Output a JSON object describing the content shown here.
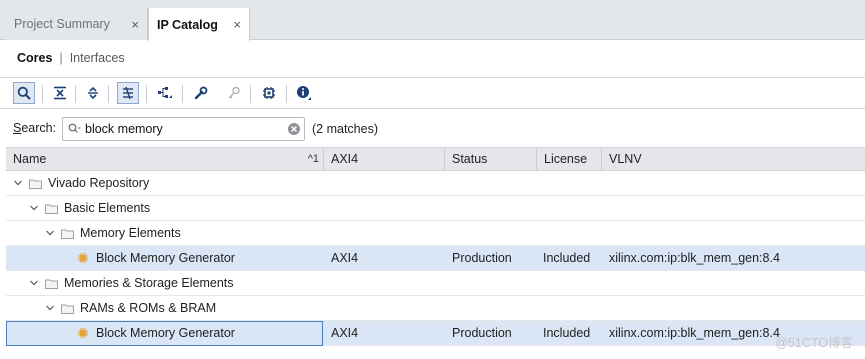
{
  "tabs": [
    {
      "label": "Project Summary",
      "close": "×"
    },
    {
      "label": "IP Catalog",
      "close": "×"
    }
  ],
  "subtabs": {
    "selected": "Cores",
    "separator": "|",
    "other": "Interfaces"
  },
  "toolbar": {
    "icons": [
      "search-icon",
      "collapse-all-icon",
      "expand-all-icon",
      "flatten-hierarchy-icon",
      "hierarchy-icon",
      "customize-wrench-icon",
      "key-icon",
      "chip-icon",
      "info-icon"
    ]
  },
  "search": {
    "label_prefix": "S",
    "label_rest": "earch:",
    "value": "block memory",
    "matches": "(2 matches)"
  },
  "table": {
    "columns": [
      "Name",
      "AXI4",
      "Status",
      "License",
      "VLNV"
    ],
    "sort_indicator": "^1",
    "rows": [
      {
        "level": 0,
        "type": "folder",
        "name": "Vivado Repository",
        "axi4": "",
        "status": "",
        "license": "",
        "vlnv": ""
      },
      {
        "level": 1,
        "type": "folder",
        "name": "Basic Elements",
        "axi4": "",
        "status": "",
        "license": "",
        "vlnv": ""
      },
      {
        "level": 2,
        "type": "folder",
        "name": "Memory Elements",
        "axi4": "",
        "status": "",
        "license": "",
        "vlnv": ""
      },
      {
        "level": 3,
        "type": "ip",
        "name": "Block Memory Generator",
        "axi4": "AXI4",
        "status": "Production",
        "license": "Included",
        "vlnv": "xilinx.com:ip:blk_mem_gen:8.4"
      },
      {
        "level": 1,
        "type": "folder",
        "name": "Memories & Storage Elements",
        "axi4": "",
        "status": "",
        "license": "",
        "vlnv": ""
      },
      {
        "level": 2,
        "type": "folder",
        "name": "RAMs & ROMs & BRAM",
        "axi4": "",
        "status": "",
        "license": "",
        "vlnv": ""
      },
      {
        "level": 3,
        "type": "ip",
        "name": "Block Memory Generator",
        "axi4": "AXI4",
        "status": "Production",
        "license": "Included",
        "vlnv": "xilinx.com:ip:blk_mem_gen:8.4"
      }
    ]
  },
  "watermark": "@51CTO博客",
  "colors": {
    "selected_row": "#dae6f5",
    "header_bg": "#e4e6e9",
    "focus_border": "#4a7cc4",
    "ip_icon": "#e8a33a"
  }
}
